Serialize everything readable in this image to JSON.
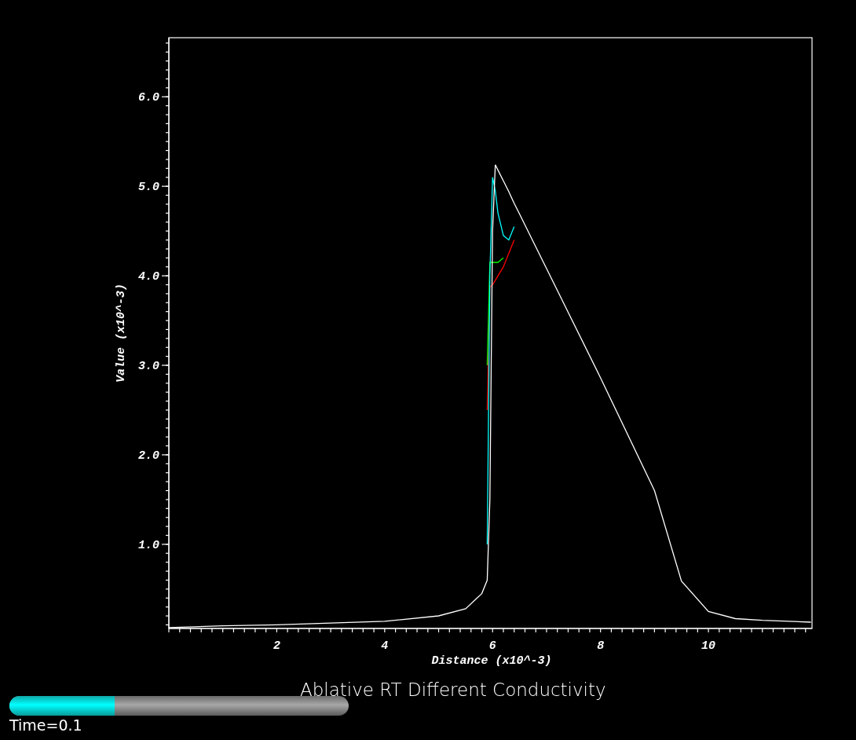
{
  "plot": {
    "chart_data": {
      "type": "line",
      "xlabel": "Distance (x10^-3)",
      "ylabel": "Value (x10^-3)",
      "x": [
        0,
        1,
        2,
        3,
        4,
        5,
        5.5,
        5.8,
        5.9,
        5.95,
        6.0,
        6.05,
        6.1,
        6.2,
        6.3,
        6.4,
        6.5,
        7,
        8,
        9,
        9.5,
        10,
        10.5,
        11,
        11.9
      ],
      "series": [
        {
          "color": "#ff0000",
          "values": [
            null,
            null,
            null,
            null,
            null,
            null,
            null,
            null,
            2.5,
            3.87,
            3.9,
            3.95,
            4.0,
            4.1,
            4.25,
            4.4,
            null,
            null,
            null,
            null,
            null,
            null,
            null,
            null,
            null
          ]
        },
        {
          "color": "#00ff00",
          "values": [
            null,
            null,
            null,
            null,
            null,
            null,
            null,
            null,
            3.0,
            4.15,
            4.15,
            4.15,
            4.15,
            4.2,
            null,
            null,
            null,
            null,
            null,
            null,
            null,
            null,
            null,
            null,
            null
          ]
        },
        {
          "color": "#00ffff",
          "values": [
            null,
            null,
            null,
            null,
            null,
            null,
            null,
            null,
            1.0,
            4.0,
            5.1,
            4.95,
            4.7,
            4.45,
            4.4,
            4.55,
            null,
            null,
            null,
            null,
            null,
            null,
            null,
            null,
            null
          ]
        },
        {
          "color": "#ffffff",
          "values": [
            0.07,
            0.09,
            0.1,
            0.12,
            0.14,
            0.2,
            0.28,
            0.45,
            0.6,
            1.5,
            4.5,
            5.24,
            5.18,
            5.06,
            4.94,
            4.81,
            4.69,
            4.08,
            2.86,
            1.6,
            0.59,
            0.25,
            0.17,
            0.15,
            0.13
          ]
        }
      ],
      "xlim": [
        0,
        11.92
      ],
      "ylim": [
        0.06,
        6.66
      ],
      "xticks": [
        2,
        4,
        6,
        8,
        10
      ],
      "yticks": [
        {
          "value": 1,
          "label": "1.0"
        },
        {
          "value": 2,
          "label": "2.0"
        },
        {
          "value": 3,
          "label": "3.0"
        },
        {
          "value": 4,
          "label": "4.0"
        },
        {
          "value": 5,
          "label": "5.0"
        },
        {
          "value": 6,
          "label": "6.0"
        }
      ]
    }
  },
  "title": "Ablative RT Different Conductivity",
  "time_slider": {
    "level": 0.31,
    "label": "Time=0.1"
  }
}
